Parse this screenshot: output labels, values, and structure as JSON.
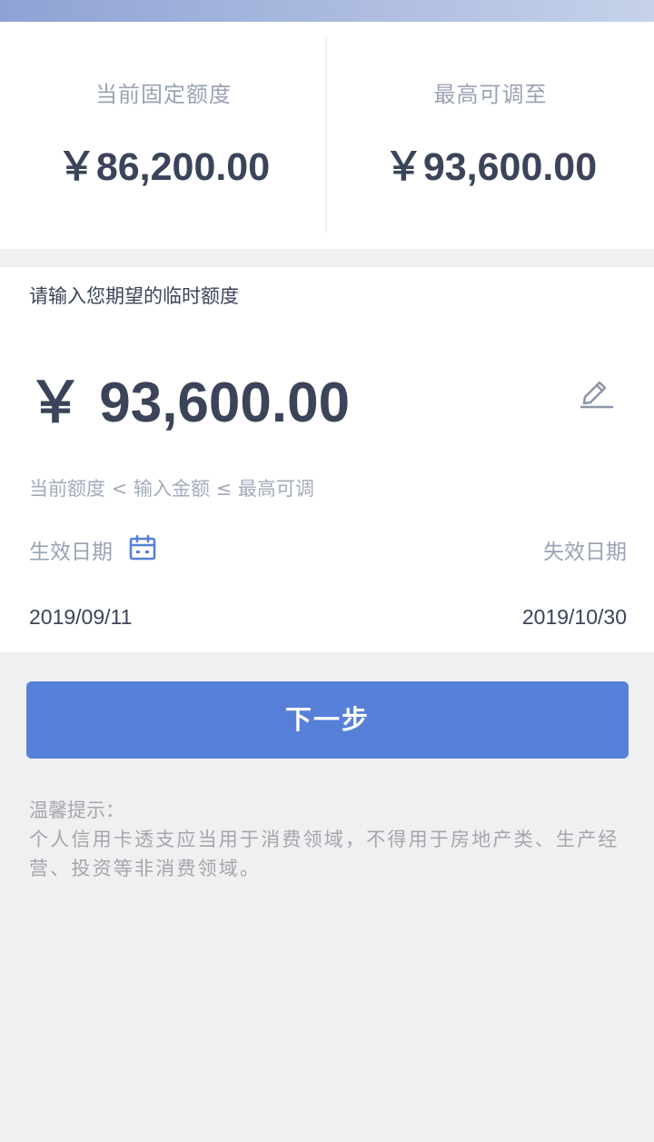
{
  "colors": {
    "accent": "#5680d8",
    "text_dark": "#3b4459",
    "text_muted": "#9aa3b4",
    "background": "#f0f0f1"
  },
  "limits": {
    "current": {
      "label": "当前固定额度",
      "value": "￥86,200.00"
    },
    "max": {
      "label": "最高可调至",
      "value": "￥93,600.00"
    }
  },
  "form": {
    "prompt": "请输入您期望的临时额度",
    "amount": "￥ 93,600.00",
    "edit_icon": "pencil-icon",
    "range_hint": "当前额度 < 输入金额 ≤ 最高可调",
    "effective_label": "生效日期",
    "calendar_icon": "calendar-icon",
    "expire_label": "失效日期",
    "start_date": "2019/09/11",
    "end_date": "2019/10/30"
  },
  "actions": {
    "next_label": "下一步"
  },
  "tips": {
    "title": "温馨提示：",
    "body": "个人信用卡透支应当用于消费领域，不得用于房地产类、生产经营、投资等非消费领域。"
  }
}
